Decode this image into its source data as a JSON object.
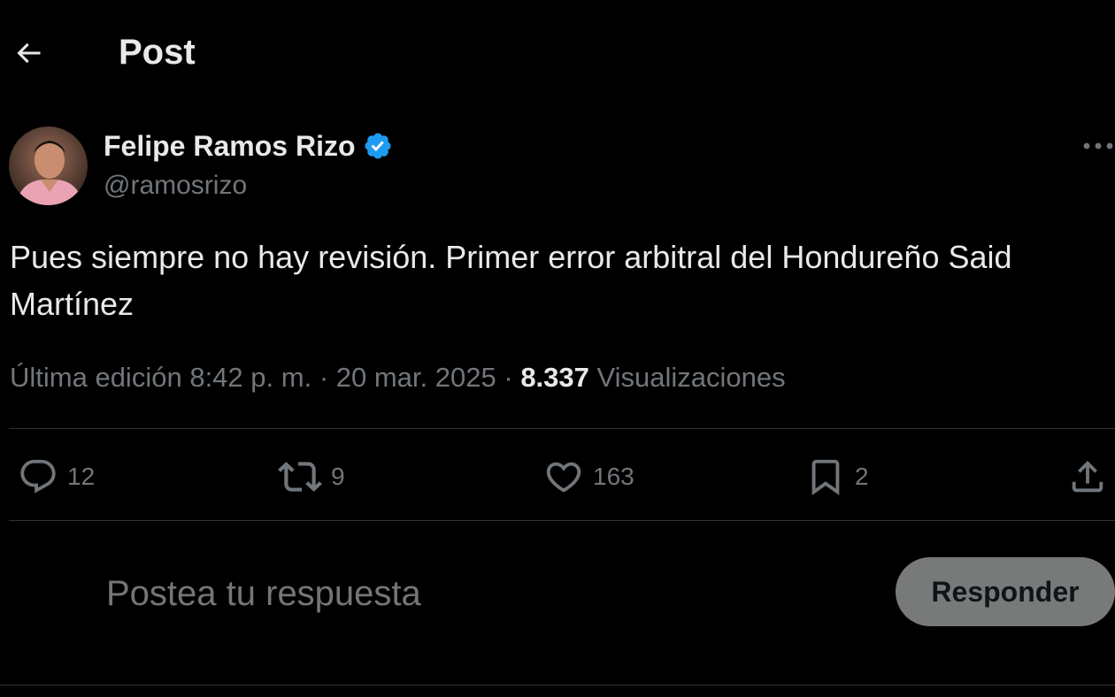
{
  "header": {
    "title": "Post"
  },
  "post": {
    "author": {
      "name": "Felipe Ramos Rizo",
      "handle": "@ramosrizo",
      "verified_color": "#1d9bf0"
    },
    "text_line1": "Pues siempre no hay revisión. Primer error arbitral del Hondureño Said",
    "text_line2": "Martínez",
    "meta": {
      "edited_prefix": "Última edición",
      "time": "8:42 p. m.",
      "separator": "·",
      "date": "20 mar. 2025",
      "views": "8.337",
      "views_label": "Visualizaciones"
    },
    "actions": {
      "replies": "12",
      "reposts": "9",
      "likes": "163",
      "bookmarks": "2"
    }
  },
  "reply": {
    "placeholder": "Postea tu respuesta",
    "button_label": "Responder"
  },
  "icons": [
    "back-arrow-icon",
    "verified-badge-icon",
    "more-icon",
    "reply-icon",
    "repost-icon",
    "like-icon",
    "bookmark-icon",
    "share-icon"
  ]
}
